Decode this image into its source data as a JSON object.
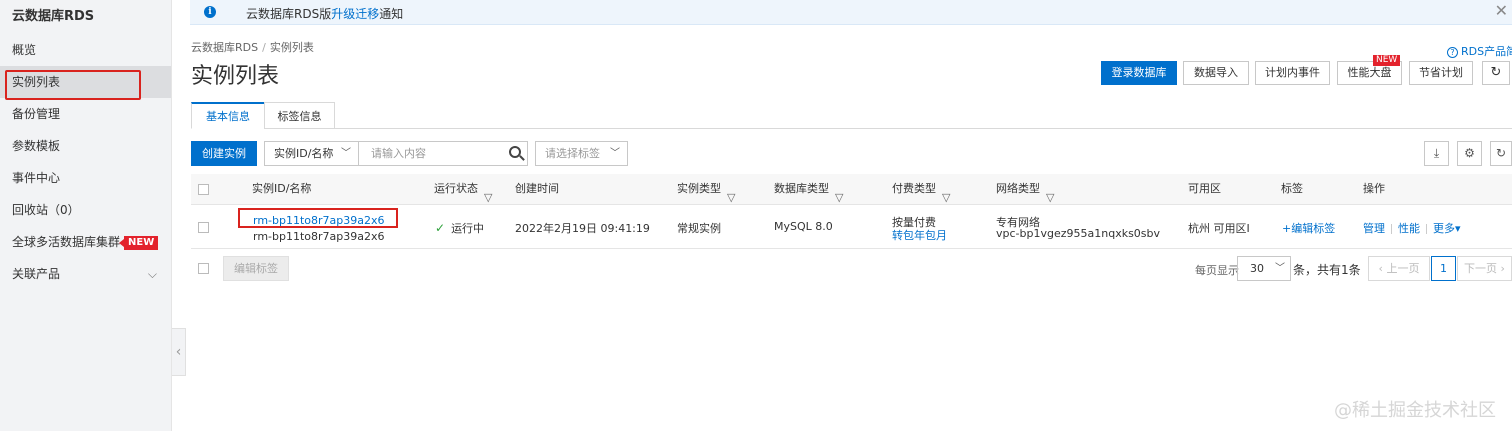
{
  "sidebar": {
    "title": "云数据库RDS",
    "items": [
      {
        "label": "概览"
      },
      {
        "label": "实例列表"
      },
      {
        "label": "备份管理"
      },
      {
        "label": "参数模板"
      },
      {
        "label": "事件中心"
      },
      {
        "label": "回收站（0）"
      },
      {
        "label": "全球多活数据库集群",
        "badge": "NEW"
      },
      {
        "label": "关联产品"
      }
    ]
  },
  "notice": {
    "text_prefix": "云数据库RDS版",
    "link": "升级迁移",
    "text_suffix": "通知"
  },
  "breadcrumb": {
    "root": "云数据库RDS",
    "sep": "/",
    "current": "实例列表"
  },
  "page_title": "实例列表",
  "intro_link": "RDS产品简介",
  "header_buttons": {
    "login_db": "登录数据库",
    "data_import": "数据导入",
    "planned_events": "计划内事件",
    "performance": "性能大盘",
    "performance_badge": "NEW",
    "save_plan": "节省计划"
  },
  "tabs": [
    {
      "label": "基本信息"
    },
    {
      "label": "标签信息"
    }
  ],
  "toolbar": {
    "create_label": "创建实例",
    "search_type": "实例ID/名称",
    "search_placeholder": "请输入内容",
    "tag_placeholder": "请选择标签"
  },
  "table": {
    "headers": {
      "id_name": "实例ID/名称",
      "status": "运行状态",
      "created": "创建时间",
      "type": "实例类型",
      "db_type": "数据库类型",
      "billing": "付费类型",
      "network": "网络类型",
      "zone": "可用区",
      "tags": "标签",
      "actions": "操作"
    },
    "rows": [
      {
        "id": "rm-bp11to8r7ap39a2x6",
        "name": "rm-bp11to8r7ap39a2x6",
        "status": "运行中",
        "created": "2022年2月19日 09:41:19",
        "type": "常规实例",
        "db_type": "MySQL 8.0",
        "billing": "按量付费",
        "billing_link": "转包年包月",
        "network": "专有网络",
        "vpc": "vpc-bp1vgez955a1nqxks0sbv",
        "zone": "杭州 可用区I",
        "tags": "+编辑标签",
        "action_manage": "管理",
        "action_perf": "性能",
        "action_more": "更多"
      }
    ]
  },
  "footer": {
    "edit_tags": "编辑标签",
    "per_page_label": "每页显示",
    "per_page_value": "30",
    "total": "条，共有1条",
    "prev": "上一页",
    "page": "1",
    "next": "下一页"
  },
  "watermark": "@稀土掘金技术社区",
  "colors": {
    "accent": "#0070cc",
    "danger": "#e3222c",
    "success": "#2ea13b"
  }
}
